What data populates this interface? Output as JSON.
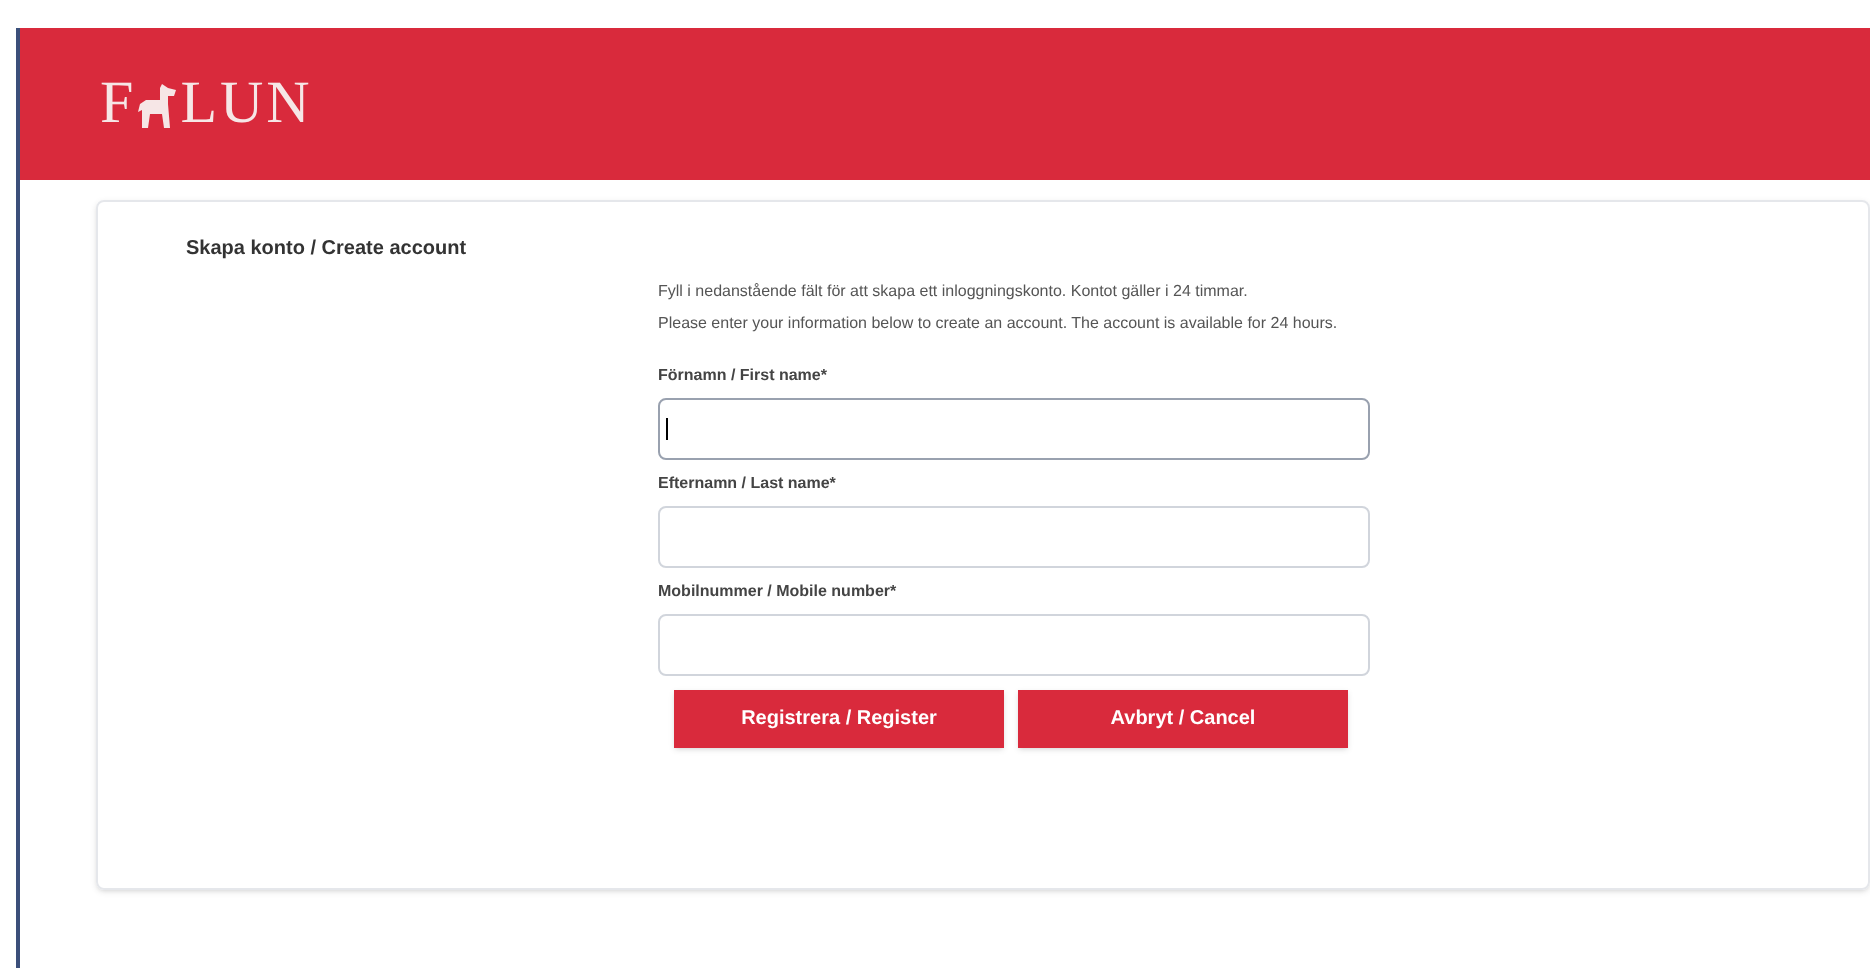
{
  "header": {
    "logo_left": "F",
    "logo_right": "LUN"
  },
  "form": {
    "title": "Skapa konto / Create account",
    "intro": [
      "Fyll i nedanstående fält för att skapa ett inloggningskonto. Kontot gäller i 24 timmar.",
      "Please enter your information below to create an account. The account is available for 24 hours."
    ],
    "fields": [
      {
        "label": "Förnamn / First name*",
        "focused": true
      },
      {
        "label": "Efternamn / Last name*",
        "focused": false
      },
      {
        "label": "Mobilnummer / Mobile number*",
        "focused": false
      }
    ],
    "buttons": [
      "Registrera / Register",
      "Avbryt / Cancel"
    ]
  }
}
